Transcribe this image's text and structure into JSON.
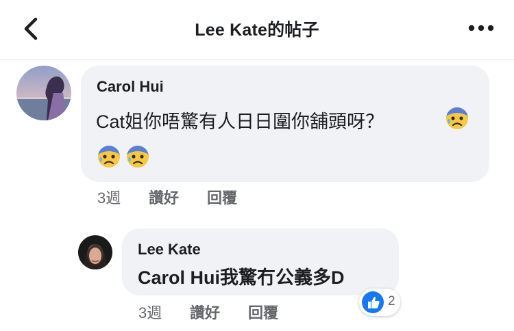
{
  "header": {
    "title": "Lee Kate的帖子"
  },
  "comments": [
    {
      "author": "Carol Hui",
      "text": "Cat姐你唔驚有人日日圍你舖頭呀？",
      "time": "3週",
      "like_label": "讚好",
      "reply_label": "回覆"
    },
    {
      "author": "Lee Kate",
      "text": "Carol Hui我驚冇公義多D",
      "time": "3週",
      "like_label": "讚好",
      "reply_label": "回覆",
      "reaction_count": "2"
    }
  ],
  "icons": {
    "back": "chevron-left-icon",
    "more": "more-horizontal-icon",
    "emoji": "anxious-face-with-sweat-emoji",
    "like": "thumbs-up-icon"
  },
  "colors": {
    "bubble": "#f0f2f5",
    "like_blue": "#1877f2",
    "secondary_text": "#65676b"
  }
}
